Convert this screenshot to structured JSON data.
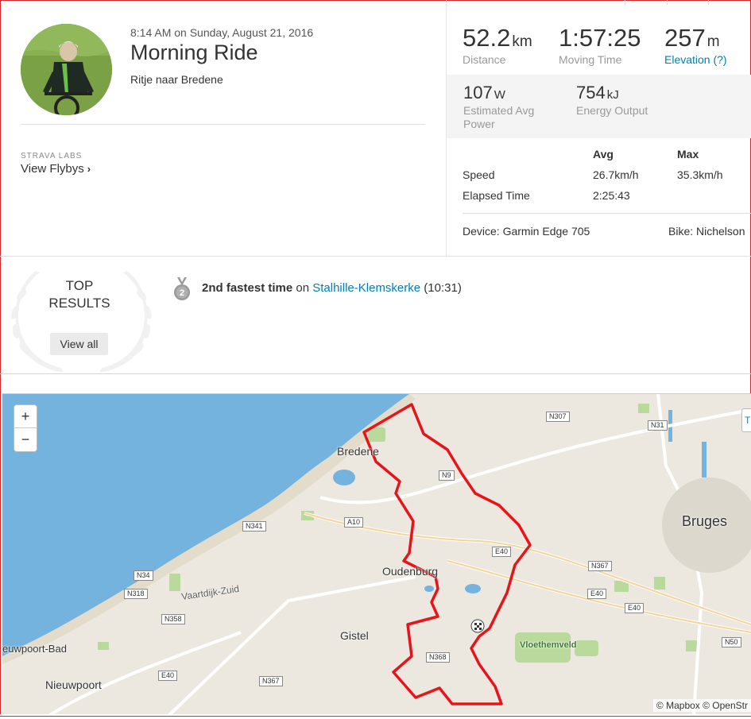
{
  "activity": {
    "datetime": "8:14 AM on Sunday, August 21, 2016",
    "title": "Morning Ride",
    "description": "Ritje naar Bredene",
    "labs_label": "STRAVA LABS",
    "flybys_label": "View Flybys"
  },
  "stats": {
    "distance": {
      "value": "52.2",
      "unit": "km",
      "label": "Distance"
    },
    "moving_time": {
      "value": "1:57:25",
      "label": "Moving Time"
    },
    "elevation": {
      "value": "257",
      "unit": "m",
      "label": "Elevation (?)"
    },
    "power": {
      "value": "107",
      "unit": "W",
      "label_line1": "Estimated Avg",
      "label_line2": "Power"
    },
    "energy": {
      "value": "754",
      "unit": "kJ",
      "label": "Energy Output"
    },
    "table": {
      "col_avg": "Avg",
      "col_max": "Max",
      "rows": [
        {
          "label": "Speed",
          "avg": "26.7km/h",
          "max": "35.3km/h"
        },
        {
          "label": "Elapsed Time",
          "avg": "2:25:43",
          "max": ""
        }
      ]
    },
    "device": "Device: Garmin Edge 705",
    "bike": "Bike: Nichelson"
  },
  "top_results": {
    "title_line1": "TOP",
    "title_line2": "RESULTS",
    "view_all": "View all",
    "medal_rank": "2",
    "achievement_strong": "2nd fastest time",
    "achievement_on": "on",
    "segment_name": "Stalhille-Klemskerke",
    "segment_time": "(10:31)"
  },
  "map": {
    "zoom_in": "+",
    "zoom_out": "−",
    "toggle_label": "T",
    "attribution": "© Mapbox © OpenStr",
    "places": {
      "bredene": "Bredene",
      "bruges": "Bruges",
      "oudenburg": "Oudenburg",
      "gistel": "Gistel",
      "nieuwpoort": "Nieuwpoort",
      "nieuwpoort_bad": "euwpoort-Bad",
      "vloethemveld": "Vloethemveld",
      "vaartdijk": "Vaartdijk-Zuid"
    },
    "roads": {
      "n307": "N307",
      "n31": "N31",
      "n9": "N9",
      "n341": "N341",
      "a10": "A10",
      "e40_a": "E40",
      "e40_b": "E40",
      "e40_c": "E40",
      "e40_d": "E40",
      "n367_a": "N367",
      "n367_b": "N367",
      "n34": "N34",
      "n318": "N318",
      "n358": "N358",
      "n368": "N368",
      "n50": "N50"
    },
    "colors": {
      "sea": "#6fb3df",
      "land": "#ece8df",
      "route": "#e5151c",
      "park": "#b5d89a"
    }
  }
}
